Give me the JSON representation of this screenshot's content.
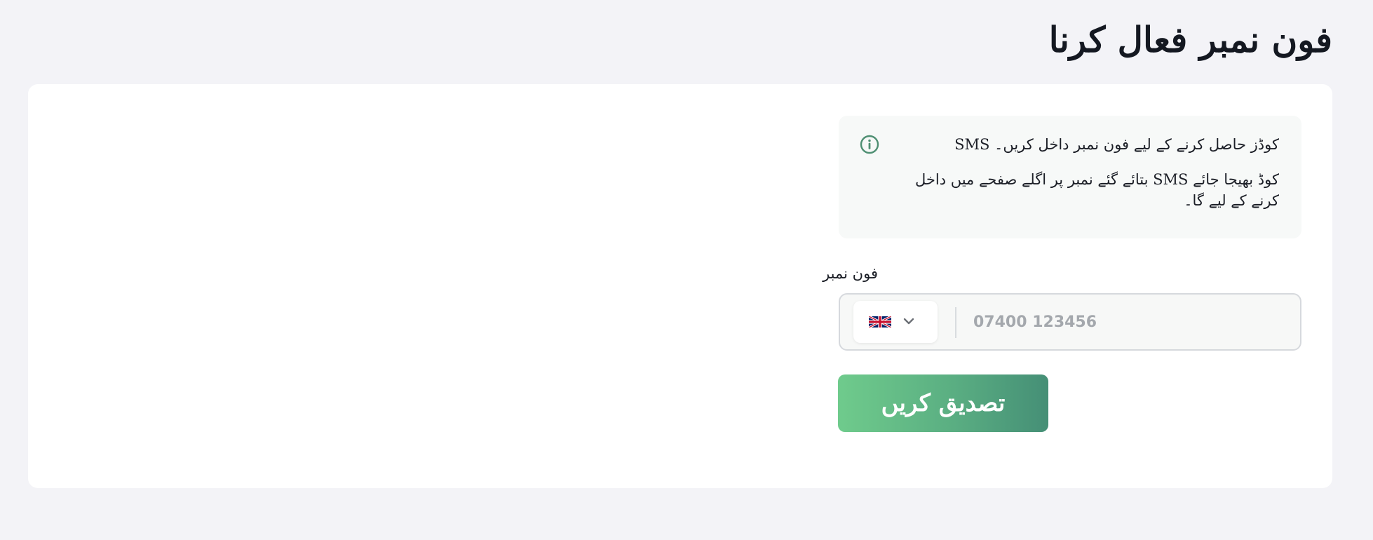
{
  "page": {
    "title": "فون نمبر فعال کرنا"
  },
  "info": {
    "icon": "info-circle-icon",
    "accent_color": "#4e8f72",
    "line1": "کوڈز حاصل کرنے کے لیے فون نمبر داخل کریں۔ SMS",
    "line2": "کوڈ بھیجا جائے SMS بتائے گئے نمبر پر اگلے صفحے میں داخل کرنے کے لیے گا۔"
  },
  "phone": {
    "label": "فون نمبر",
    "country_flag": "uk-flag-icon",
    "dropdown_icon": "chevron-down-icon",
    "value": "",
    "placeholder": "07400 123456"
  },
  "actions": {
    "verify_label": "تصدیق کریں",
    "button_gradient": [
      "#6fcb8c",
      "#458f76"
    ]
  }
}
